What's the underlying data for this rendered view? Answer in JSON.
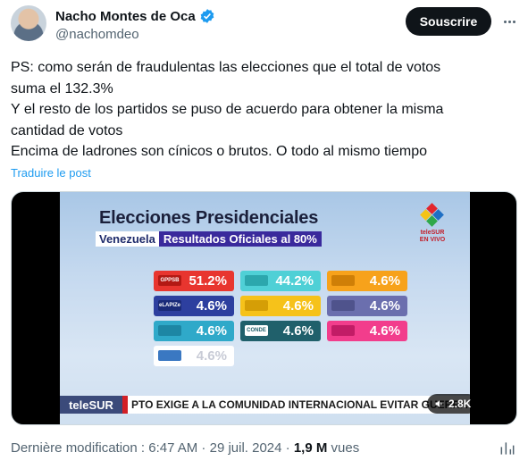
{
  "author": {
    "display_name": "Nacho Montes de Oca",
    "handle": "@nachomdeo",
    "verified_icon": "verified-badge-icon"
  },
  "actions": {
    "subscribe_label": "Souscrire",
    "more_icon": "more-horizontal-icon"
  },
  "tweet": {
    "lines": [
      "PS: como serán de fraudulentas las elecciones que el total de votos",
      "suma el 132.3%",
      "Y el resto de los partidos se puso de acuerdo para obtener la misma",
      "cantidad de votos",
      "Encima de ladrones son cínicos o brutos. O todo al mismo tiempo"
    ],
    "translate_label": "Traduire le post"
  },
  "media": {
    "title": "Elecciones Presidenciales",
    "country": "Venezuela",
    "results_label": "Resultados Oficiales al 80%",
    "channel_tag": "EN VIVO",
    "channel_logo": "teleSUR",
    "cells": [
      {
        "party": "GPPSB",
        "pct": "51.2%",
        "color": "#e8352f",
        "badge": "#b31914"
      },
      {
        "party": "",
        "pct": "44.2%",
        "color": "#4fd0d6",
        "badge": "#2ca7ad"
      },
      {
        "party": "",
        "pct": "4.6%",
        "color": "#f7a21b",
        "badge": "#cf7f07"
      },
      {
        "party": "eLAPIZe",
        "pct": "4.6%",
        "color": "#2d3f9f",
        "badge": "#1a2a78"
      },
      {
        "party": "",
        "pct": "4.6%",
        "color": "#f6c21a",
        "badge": "#d59e06"
      },
      {
        "party": "",
        "pct": "4.6%",
        "color": "#6b6fae",
        "badge": "#4f538c"
      },
      {
        "party": "",
        "pct": "4.6%",
        "color": "#2fa9c9",
        "badge": "#1d86a4"
      },
      {
        "party": "CONDE",
        "pct": "4.6%",
        "color": "#20606b",
        "badge": "#ffffff"
      },
      {
        "party": "",
        "pct": "4.6%",
        "color": "#f23d8c",
        "badge": "#c21c66"
      },
      {
        "party": "",
        "pct": "4.6%",
        "color": "#ffffff",
        "badge": "#3a78c2"
      }
    ],
    "ticker_brand": "teleSUR",
    "ticker_text": "PTO EXIGE A LA COMUNIDAD INTERNACIONAL EVITAR GUERRA ENTRE IS",
    "views_count": "2.8K",
    "views_icon": "play-audio-icon"
  },
  "footer": {
    "modified_label": "Dernière modification : 6:47 AM · 29 juil. 2024 · ",
    "views_value": "1,9 M",
    "views_label": " vues",
    "stats_icon": "analytics-icon"
  }
}
